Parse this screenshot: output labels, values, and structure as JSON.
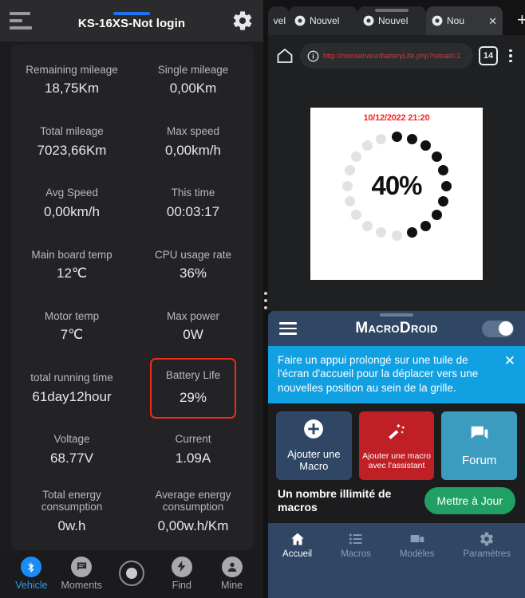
{
  "kingsong": {
    "header": {
      "title": "KS-16XS-Not login",
      "menu_icon": "hamburger-icon",
      "settings_icon": "gear-icon"
    },
    "stats": [
      [
        {
          "label": "Remaining mileage",
          "value": "18,75Km"
        },
        {
          "label": "Single mileage",
          "value": "0,00Km"
        }
      ],
      [
        {
          "label": "Total mileage",
          "value": "7023,66Km"
        },
        {
          "label": "Max speed",
          "value": "0,00km/h"
        }
      ],
      [
        {
          "label": "Avg Speed",
          "value": "0,00km/h"
        },
        {
          "label": "This time",
          "value": "00:03:17"
        }
      ],
      [
        {
          "label": "Main board temp",
          "value": "12℃"
        },
        {
          "label": "CPU usage rate",
          "value": "36%"
        }
      ],
      [
        {
          "label": "Motor temp",
          "value": "7℃"
        },
        {
          "label": "Max power",
          "value": "0W"
        }
      ],
      [
        {
          "label": "total running time",
          "value": "61day12hour"
        },
        {
          "label": "Battery Life",
          "value": "29%",
          "highlight": true
        }
      ],
      [
        {
          "label": "Voltage",
          "value": "68.77V"
        },
        {
          "label": "Current",
          "value": "1.09A"
        }
      ],
      [
        {
          "label": "Total energy consumption",
          "value": "0w.h"
        },
        {
          "label": "Average energy consumption",
          "value": "0,00w.h/Km"
        }
      ]
    ],
    "highlight_color": "#f02b1d",
    "nav": [
      {
        "label": "Vehicle",
        "icon": "bluetooth-icon",
        "active": true
      },
      {
        "label": "Moments",
        "icon": "chat-icon",
        "active": false
      },
      {
        "label": "",
        "icon": "record-icon",
        "active": false
      },
      {
        "label": "Find",
        "icon": "find-icon",
        "active": false
      },
      {
        "label": "Mine",
        "icon": "person-icon",
        "active": false
      }
    ]
  },
  "browser": {
    "tabs": [
      {
        "title": "vel",
        "favicon": "chrome-icon",
        "active": false,
        "partial": true
      },
      {
        "title": "Nouvel",
        "favicon": "chrome-icon",
        "active": false
      },
      {
        "title": "Nouvel",
        "favicon": "chrome-icon",
        "active": false
      },
      {
        "title": "Nou",
        "favicon": "chrome-icon",
        "active": true,
        "close_icon": "close-icon"
      }
    ],
    "new_tab_label": "+",
    "home_icon": "home-icon",
    "info_icon": "info-icon",
    "url": "http://monserveur/batteryLife.php?reload=1",
    "url_color": "#e8313a",
    "tab_count": "14",
    "menu_icon": "kebab-menu-icon"
  },
  "gauge": {
    "date": "10/12/2022 21:20",
    "date_color": "#fb1f1f",
    "percent_label": "40%",
    "total_dots": 20,
    "filled_dots": 10
  },
  "macrodroid": {
    "header": {
      "brand": "MacroDroid",
      "menu_icon": "hamburger-icon",
      "toggle_icon": "toggle-on-icon",
      "toggle_on": true
    },
    "tip": {
      "text": "Faire un appui prolongé sur une tuile de l'écran d'accueil pour la déplacer vers une nouvelles position au sein de la grille.",
      "close_icon": "close-icon",
      "background": "#11a0e2"
    },
    "tiles": [
      {
        "label": "Ajouter une Macro",
        "icon": "plus-circle-icon",
        "color": "#2f4764"
      },
      {
        "label": "Ajouter une macro avec l'assistant",
        "icon": "magic-wand-icon",
        "color": "#bf2026"
      },
      {
        "label": "Forum",
        "icon": "forum-chat-icon",
        "color": "#3c9cc0"
      }
    ],
    "upgrade": {
      "text": "Un nombre illimité de macros",
      "button_label": "Mettre à Jour",
      "button_color": "#21a063"
    },
    "nav": [
      {
        "label": "Accueil",
        "icon": "home-icon",
        "active": true
      },
      {
        "label": "Macros",
        "icon": "list-icon",
        "active": false
      },
      {
        "label": "Modèles",
        "icon": "templates-icon",
        "active": false
      },
      {
        "label": "Paramètres",
        "icon": "gear-icon",
        "active": false
      }
    ]
  }
}
